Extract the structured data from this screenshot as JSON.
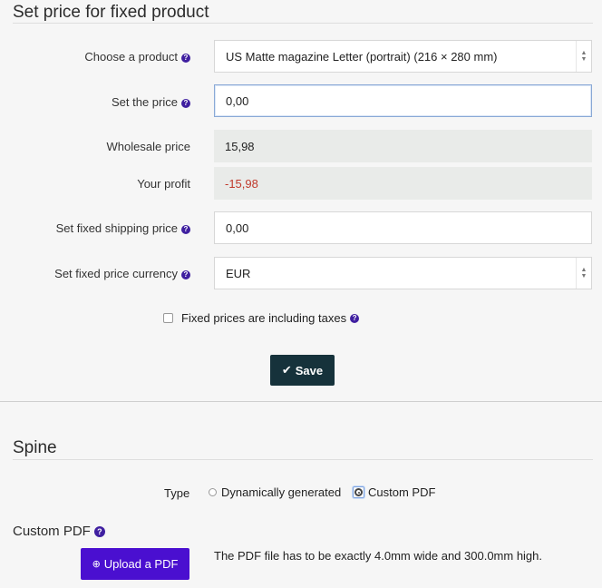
{
  "fixed_price": {
    "title": "Set price for fixed product",
    "product_label": "Choose a product",
    "product_value": "US Matte magazine Letter (portrait) (216 × 280 mm)",
    "price_label": "Set the price",
    "price_value": "0,00",
    "wholesale_label": "Wholesale price",
    "wholesale_value": "15,98",
    "profit_label": "Your profit",
    "profit_value": "-15,98",
    "shipping_label": "Set fixed shipping price",
    "shipping_value": "0,00",
    "currency_label": "Set fixed price currency",
    "currency_value": "EUR",
    "taxes_label": "Fixed prices are including taxes",
    "taxes_checked": false,
    "save_label": "Save"
  },
  "spine": {
    "title": "Spine",
    "type_label": "Type",
    "option_dynamic": "Dynamically generated",
    "option_custom": "Custom PDF",
    "selected": "Custom PDF",
    "custom_pdf_title": "Custom PDF",
    "upload_label": "Upload a PDF",
    "pdf_note": "The PDF file has to be exactly 4.0mm wide and 300.0mm high."
  },
  "colors": {
    "accent": "#4a0fd0",
    "save_button": "#16323b",
    "negative": "#c0392b",
    "help_icon": "#3f1fa0"
  }
}
